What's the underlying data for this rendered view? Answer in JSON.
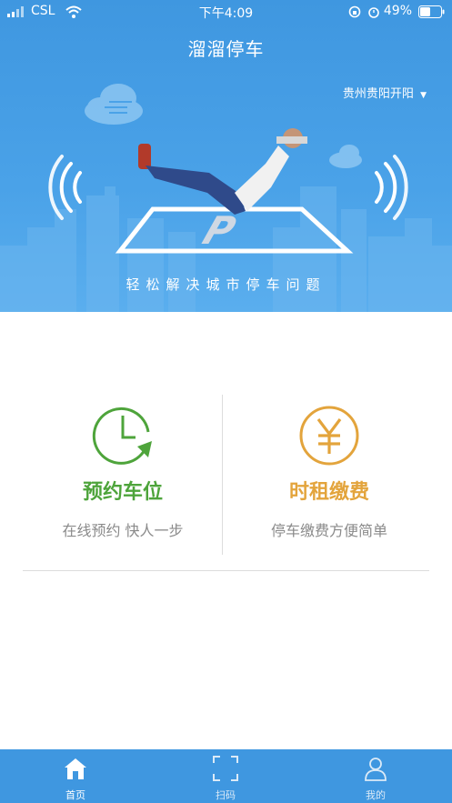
{
  "status_bar": {
    "carrier": "CSL",
    "time": "下午4:09",
    "battery": "49%"
  },
  "header": {
    "title": "溜溜停车",
    "city": "贵州贵阳开阳"
  },
  "hero": {
    "tagline": "轻松解决城市停车问题"
  },
  "features": [
    {
      "title": "预约车位",
      "subtitle": "在线预约 快人一步",
      "color": "#4ea43b",
      "icon": "clock-icon"
    },
    {
      "title": "时租缴费",
      "subtitle": "停车缴费方便简单",
      "color": "#e3a43c",
      "icon": "yen-icon"
    }
  ],
  "tabbar": {
    "items": [
      {
        "label": "首页",
        "icon": "home-icon",
        "active": true
      },
      {
        "label": "扫码",
        "icon": "scan-icon",
        "active": false
      },
      {
        "label": "我的",
        "icon": "user-icon",
        "active": false
      }
    ]
  },
  "colors": {
    "primary": "#3f97e0",
    "green": "#4ea43b",
    "orange": "#e3a43c"
  }
}
